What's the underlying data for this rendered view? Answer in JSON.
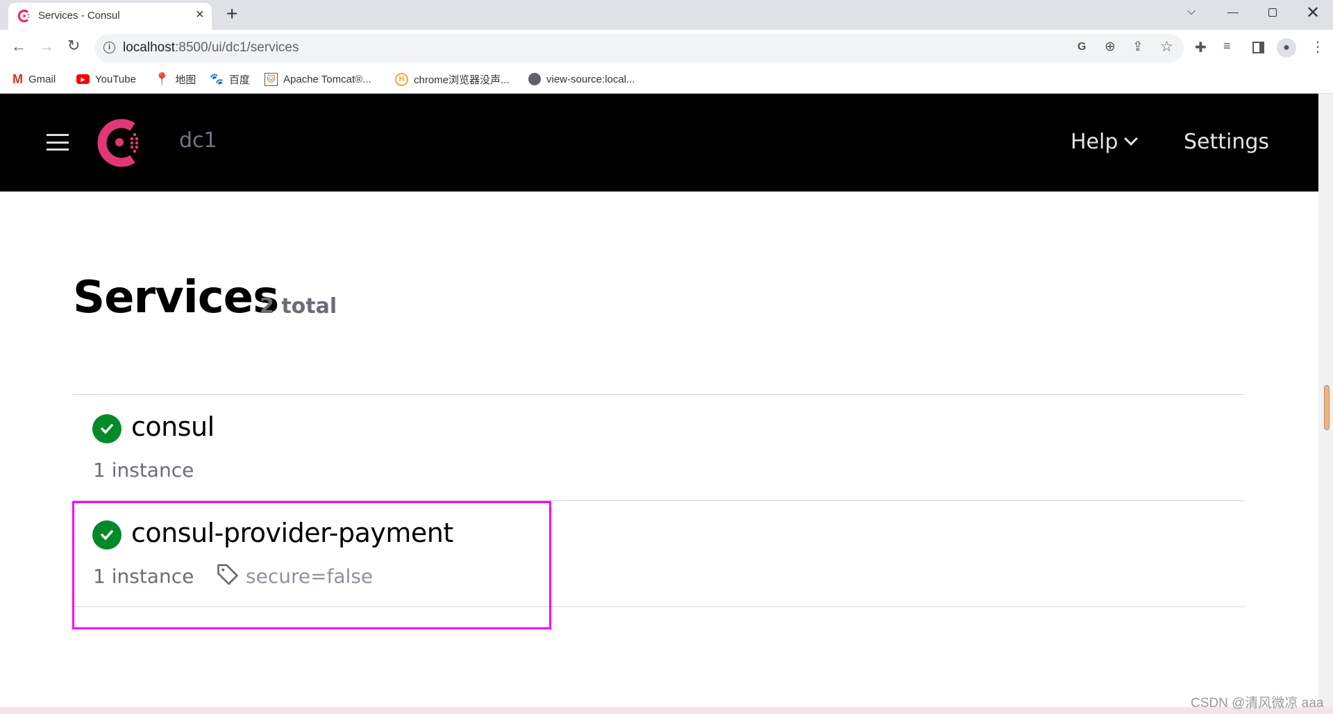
{
  "browser": {
    "tab_title": "Services - Consul",
    "url_host": "localhost",
    "url_rest": ":8500/ui/dc1/services",
    "bookmarks": [
      {
        "label": "Gmail",
        "icon": "gmail-icon"
      },
      {
        "label": "YouTube",
        "icon": "youtube-icon"
      },
      {
        "label": "地图",
        "icon": "maps-icon"
      },
      {
        "label": "百度",
        "icon": "baidu-icon"
      },
      {
        "label": "Apache Tomcat®...",
        "icon": "tomcat-icon"
      },
      {
        "label": "chrome浏览器没声...",
        "icon": "chrome-help-icon"
      },
      {
        "label": "view-source:local...",
        "icon": "globe-icon"
      }
    ]
  },
  "header": {
    "datacenter": "dc1",
    "help_label": "Help",
    "settings_label": "Settings",
    "brand_color": "#e03875"
  },
  "page": {
    "title": "Services",
    "count": "2 total"
  },
  "services": [
    {
      "name": "consul",
      "instances": "1 instance",
      "status": "passing",
      "tags": []
    },
    {
      "name": "consul-provider-payment",
      "instances": "1 instance",
      "status": "passing",
      "tags": [
        "secure=false"
      ]
    }
  ],
  "highlight_color": "#ff00ff",
  "watermark": "CSDN @清风微凉 aaa"
}
